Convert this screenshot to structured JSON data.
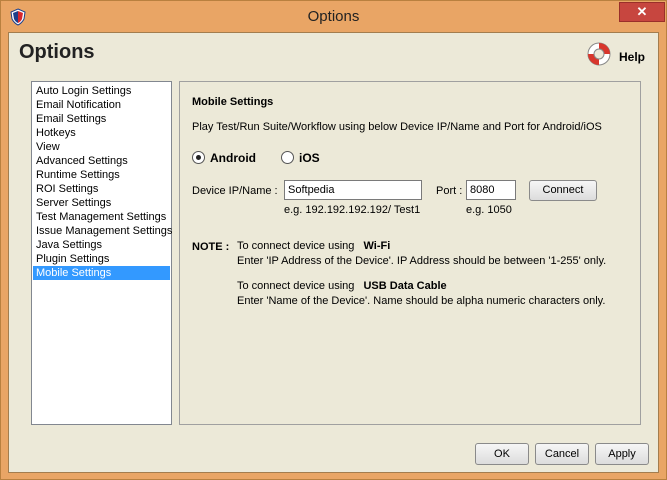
{
  "window": {
    "title": "Options",
    "close_glyph": "✕"
  },
  "header": {
    "title": "Options",
    "help_label": "Help"
  },
  "sidebar": {
    "items": [
      "Auto Login Settings",
      "Email Notification",
      "Email Settings",
      "Hotkeys",
      "View",
      "Advanced Settings",
      "Runtime Settings",
      "ROI Settings",
      "Server Settings",
      "Test Management Settings",
      "Issue Management Settings",
      "Java Settings",
      "Plugin Settings",
      "Mobile Settings"
    ],
    "selected": "Mobile Settings"
  },
  "panel": {
    "heading": "Mobile Settings",
    "description": "Play Test/Run Suite/Workflow using below Device IP/Name and Port for Android/iOS",
    "radio_android": "Android",
    "radio_ios": "iOS",
    "device_label": "Device IP/Name :",
    "device_value": "Softpedia",
    "port_label": "Port :",
    "port_value": "8080",
    "connect_label": "Connect",
    "device_example": "e.g. 192.192.192.192/ Test1",
    "port_example": "e.g. 1050",
    "note_label": "NOTE :",
    "note1_intro": "To connect device using",
    "note1_method": "Wi-Fi",
    "note1_detail": "Enter 'IP Address of the Device'. IP Address should be between '1-255' only.",
    "note2_intro": "To connect device using",
    "note2_method": "USB Data Cable",
    "note2_detail": "Enter 'Name of the Device'. Name should be alpha numeric characters only."
  },
  "footer": {
    "ok": "OK",
    "cancel": "Cancel",
    "apply": "Apply"
  },
  "colors": {
    "frame": "#e9a565",
    "selection": "#3399ff",
    "close": "#c7463f"
  }
}
